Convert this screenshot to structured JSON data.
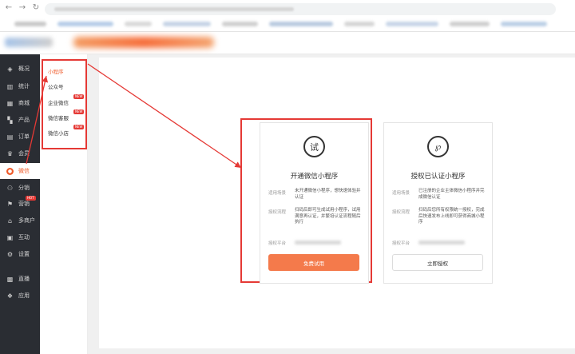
{
  "browser": {
    "nav": [
      "←",
      "→",
      "↻"
    ],
    "bookmark_colors": [
      "#c9c9c9",
      "#b7cde8",
      "#d9d9d9",
      "#c6d4e6",
      "#d0d0d0",
      "#b9cbe0",
      "#d6d6d6",
      "#c8d6e8",
      "#cfcfcf",
      "#bcd0e6"
    ]
  },
  "sidebar": {
    "items": [
      {
        "label": "概况",
        "icon": "layers-icon",
        "glyph": "◈"
      },
      {
        "label": "统计",
        "icon": "chart-icon",
        "glyph": "▥"
      },
      {
        "label": "商城",
        "icon": "store-icon",
        "glyph": "▦"
      },
      {
        "label": "产品",
        "icon": "grid-icon",
        "glyph": "▚"
      },
      {
        "label": "订单",
        "icon": "order-icon",
        "glyph": "▤"
      },
      {
        "label": "会员",
        "icon": "crown-icon",
        "glyph": "♛"
      },
      {
        "label": "微信",
        "icon": "wechat-icon",
        "glyph": "●",
        "active": true
      },
      {
        "label": "分销",
        "icon": "users-icon",
        "glyph": "⚇"
      },
      {
        "label": "营销",
        "icon": "flag-icon",
        "glyph": "⚑",
        "badge": "HOT"
      },
      {
        "label": "多商户",
        "icon": "shop-icon",
        "glyph": "⌂"
      },
      {
        "label": "互动",
        "icon": "message-icon",
        "glyph": "▣"
      },
      {
        "label": "设置",
        "icon": "gear-icon",
        "glyph": "⚙"
      },
      {
        "label": "直播",
        "icon": "live-icon",
        "glyph": "▩"
      },
      {
        "label": "应用",
        "icon": "apps-icon",
        "glyph": "❖"
      }
    ]
  },
  "submenu": {
    "items": [
      {
        "label": "小程序",
        "active": true
      },
      {
        "label": "公众号"
      },
      {
        "label": "企业微信",
        "badge": "NEW"
      },
      {
        "label": "微信客服",
        "badge": "NEW"
      },
      {
        "label": "微信小店",
        "badge": "NEW"
      }
    ]
  },
  "cards": [
    {
      "icon_glyph": "试",
      "icon": "trial-icon",
      "title": "开通微信小程序",
      "scene_label": "适用场景",
      "scene_text": "未开通微信小程序，想快速体验并认证",
      "process_label": "授权流程",
      "process_text": "扫码后即可生成试用小程序，试用满意再认证，并繁培认证流程随后执行",
      "platform_label": "授权平台",
      "button": "免费试用"
    },
    {
      "icon_glyph": "℘",
      "icon": "link-icon",
      "title": "授权已认证小程序",
      "scene_label": "适用场景",
      "scene_text": "已注册的企业主体微信小程序并完成微信认证",
      "process_label": "授权流程",
      "process_text": "扫码后您所有权限统一授权，完成后快速发布上线即可获得商城小程序",
      "platform_label": "授权平台",
      "button": "立即授权"
    }
  ]
}
